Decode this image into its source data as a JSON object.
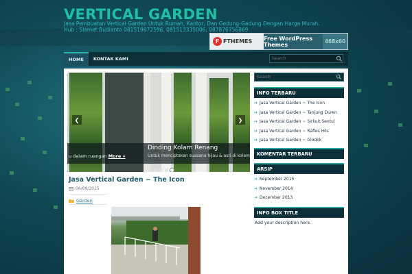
{
  "site": {
    "title": "VERTICAL GARDEN",
    "description": "Jasa Pembuatan Vertical Garden Untuk Rumah, Kantor, Dan Gedung-Gedung Dengan Harga Murah. Hub : Slamet Budianto 081519672596, 081513335006, 087876756869"
  },
  "ad": {
    "logo_mark": "F",
    "logo_text": "FTHEMES",
    "text": "Free WordPress Themes",
    "size": "468x60"
  },
  "nav": {
    "items": [
      {
        "label": "HOME"
      },
      {
        "label": "KONTAK KAMI"
      }
    ],
    "search_placeholder": "Search"
  },
  "slider": {
    "prev_text": "u dalam ruangan",
    "more_label": "More »",
    "title": "Dinding Kolam Renang",
    "subtitle": "Untuk menciptakan suasana hijau & asri di kolam renang",
    "prev_arrow": "❮",
    "next_arrow": "❯"
  },
  "post": {
    "title": "Jasa Vertical Garden ~ The Icon",
    "date": "06/09/2015",
    "category": "Garden"
  },
  "sidebar": {
    "search_placeholder": "Search",
    "info_terbaru": {
      "title": "INFO TERBARU",
      "items": [
        "Jasa Vertical Garden ~ The Icon",
        "Jasa Vertical Garden ~ Tanjung Duren",
        "Jasa Vertical Garden ~ Sirkuit Sentul",
        "Jasa Vertical Garden ~ Rafles Hils",
        "Jasa Vertical Garden ~ Glodok"
      ]
    },
    "komentar_title": "KOMENTAR TERBARU",
    "arsip": {
      "title": "ARSIP",
      "items": [
        "September 2015",
        "November 2014",
        "December 2013"
      ]
    },
    "info_box": {
      "title": "INFO BOX TITLE",
      "description": "Add your description here."
    }
  },
  "colors": {
    "accent": "#2aa7a0",
    "title": "#1fbfa6",
    "widget_bg": "#0d2f39"
  }
}
